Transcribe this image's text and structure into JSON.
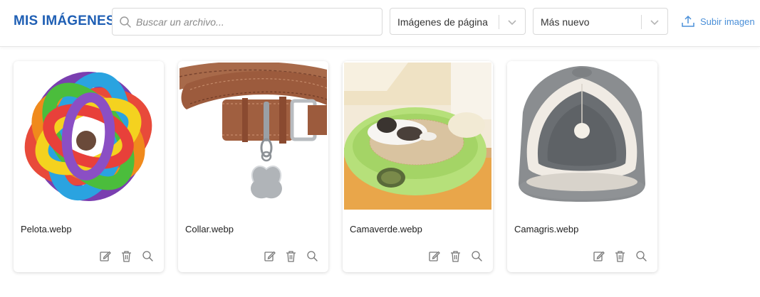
{
  "header": {
    "title": "MIS IMÁGENES",
    "search_placeholder": "Buscar un archivo...",
    "filter_select": "Imágenes de página",
    "sort_select": "Más nuevo",
    "upload_label": "Subir imagen"
  },
  "colors": {
    "brand": "#1f5fb4",
    "link": "#4a8fd8",
    "icon": "#777777"
  },
  "images": [
    {
      "filename": "Pelota.webp",
      "picture": "colorful-ball"
    },
    {
      "filename": "Collar.webp",
      "picture": "brown-collar"
    },
    {
      "filename": "Camaverde.webp",
      "picture": "green-bed-cat"
    },
    {
      "filename": "Camagris.webp",
      "picture": "grey-pet-cave"
    }
  ],
  "card_actions": [
    "edit-icon",
    "trash-icon",
    "zoom-icon"
  ]
}
